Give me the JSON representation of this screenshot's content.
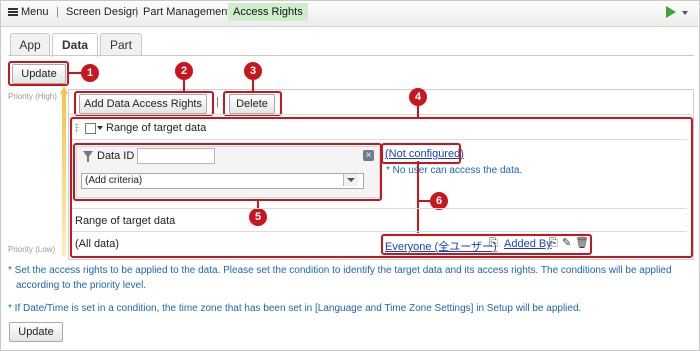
{
  "nav": {
    "menu_label": "Menu",
    "screen_design": "Screen Design",
    "part_management": "Part Management",
    "access_rights": "Access Rights"
  },
  "tabs": [
    {
      "label": "App"
    },
    {
      "label": "Data"
    },
    {
      "label": "Part"
    }
  ],
  "toolbar": {
    "update_label": "Update",
    "add_label": "Add Data Access Rights",
    "sep": "|",
    "delete_label": "Delete"
  },
  "priority": {
    "high": "Priority (High)",
    "low": "Priority (Low)"
  },
  "rule": {
    "header": "Range of target data",
    "criteria_field": "Data ID",
    "criteria_value": "",
    "add_criteria": "(Add criteria)",
    "not_configured": "(Not configured)",
    "no_user_note": "* No user can access the data."
  },
  "default_rule": {
    "header": "Range of target data",
    "all_data": "(All data)",
    "everyone": "Everyone (全ユーザー)",
    "added_by": "Added By"
  },
  "callouts": [
    "1",
    "2",
    "3",
    "4",
    "5",
    "6"
  ],
  "notes": {
    "line1": "* Set the access rights to be applied to the data. Please set the condition to identify the target data and its access rights. The conditions will be applied",
    "line2": "according to the priority level.",
    "line3": "* If Date/Time is set in a condition, the time zone that has been set in [Language and Time Zone Settings] in Setup will be applied."
  },
  "footer": {
    "update_label": "Update"
  },
  "colors": {
    "accent_green": "#cfeecb",
    "callout_red": "#c8161e",
    "link_blue": "#1a3fc0",
    "note_blue": "#1d66b0",
    "play_green": "#3aa538"
  }
}
